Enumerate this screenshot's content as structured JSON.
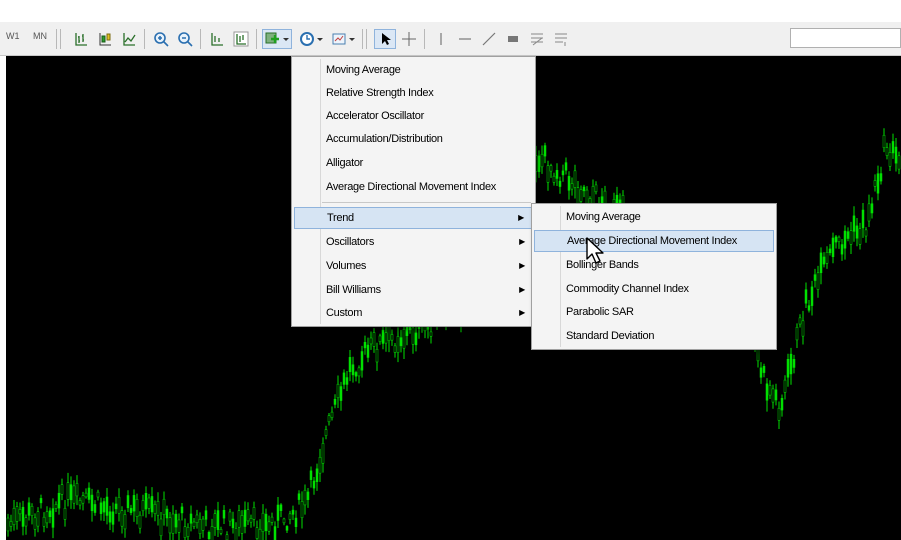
{
  "toolbar": {
    "timeframes": [
      "W1",
      "MN"
    ],
    "icons": [
      "bar-chart-icon",
      "candlestick-chart-icon",
      "line-chart-icon",
      "zoom-in-icon",
      "zoom-out-icon",
      "tile-windows-icon",
      "auto-scroll-icon",
      "indicators-icon",
      "periodicity-icon",
      "templates-icon",
      "cursor-icon",
      "crosshair-icon",
      "vertical-line-icon",
      "horizontal-line-icon",
      "trend-line-icon",
      "rectangle-icon",
      "fibonacci-icon",
      "text-icon"
    ]
  },
  "indicators_menu": {
    "items": [
      {
        "label": "Moving Average"
      },
      {
        "label": "Relative Strength Index"
      },
      {
        "label": "Accelerator Oscillator"
      },
      {
        "label": "Accumulation/Distribution"
      },
      {
        "label": "Alligator"
      },
      {
        "label": "Average Directional Movement Index"
      }
    ],
    "groups": [
      {
        "label": "Trend",
        "highlighted": true
      },
      {
        "label": "Oscillators"
      },
      {
        "label": "Volumes"
      },
      {
        "label": "Bill Williams"
      },
      {
        "label": "Custom"
      }
    ]
  },
  "trend_submenu": {
    "items": [
      {
        "label": "Moving Average"
      },
      {
        "label": "Average Directional Movement Index",
        "highlighted": true
      },
      {
        "label": "Bollinger Bands"
      },
      {
        "label": "Commodity Channel Index"
      },
      {
        "label": "Parabolic SAR"
      },
      {
        "label": "Standard Deviation"
      }
    ]
  },
  "colors": {
    "chart_background": "#000000",
    "candle_color": "#00e000",
    "highlight": "#d6e4f3",
    "highlight_border": "#8fb3dc"
  }
}
